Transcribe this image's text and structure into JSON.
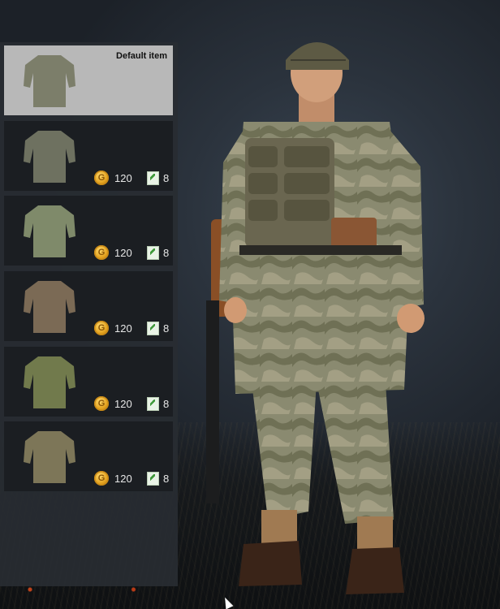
{
  "panel": {
    "items": [
      {
        "id": "default",
        "default_label": "Default item",
        "color": "#7c7e6a"
      },
      {
        "price": "120",
        "tickets": "8",
        "color": "#6e7160"
      },
      {
        "price": "120",
        "tickets": "8",
        "color": "#7f8a6a"
      },
      {
        "price": "120",
        "tickets": "8",
        "color": "#7b6a55"
      },
      {
        "price": "120",
        "tickets": "8",
        "color": "#717a4c"
      },
      {
        "price": "120",
        "tickets": "8",
        "color": "#7d7658"
      }
    ]
  },
  "icons": {
    "coin": "gold-coin-icon",
    "ticket": "green-ticket-icon",
    "coin_glyph": "G"
  },
  "colors": {
    "selected_card": "#b8b8b8",
    "card": "#1b1e22",
    "coin": "#e3a21f",
    "ticket": "#3f9a3a"
  }
}
